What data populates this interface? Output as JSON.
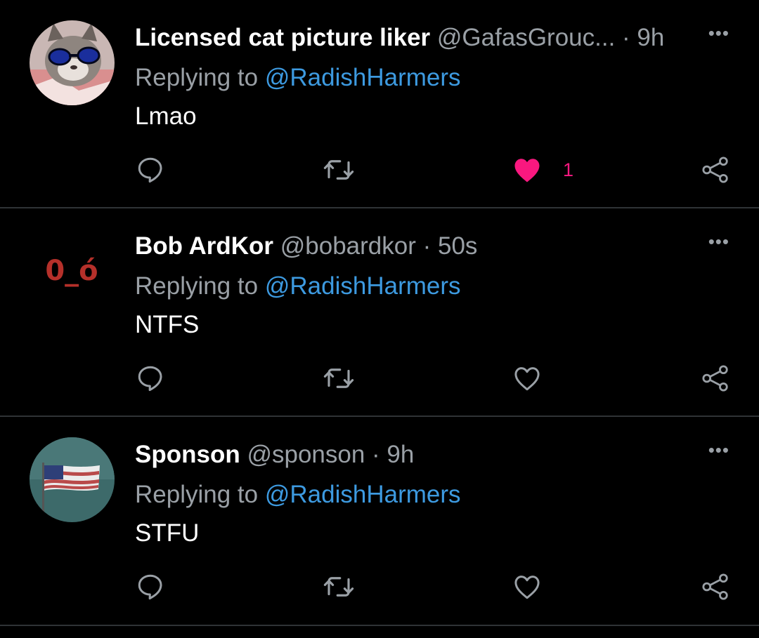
{
  "tweets": [
    {
      "name": "Licensed cat picture liker",
      "handle": "@GafasGrouc...",
      "time": "· 9h",
      "replying_prefix": "Replying to",
      "replying_to": "@RadishHarmers",
      "text": "Lmao",
      "liked": true,
      "like_count": "1",
      "avatar": "cat-sunglasses-avatar"
    },
    {
      "name": "Bob ArdKor",
      "handle": "@bobardkor",
      "time": "· 50s",
      "replying_prefix": "Replying to",
      "replying_to": "@RadishHarmers",
      "text": "NTFS",
      "liked": false,
      "like_count": "",
      "avatar_text": "0_ó"
    },
    {
      "name": "Sponson",
      "handle": "@sponson",
      "time": "· 9h",
      "replying_prefix": "Replying to",
      "replying_to": "@RadishHarmers",
      "text": "STFU",
      "liked": false,
      "like_count": "",
      "avatar": "flag-avatar"
    }
  ],
  "more_label": "•••",
  "colors": {
    "background": "#000000",
    "mention": "#3d9ae0",
    "muted": "#9aa0a6",
    "like": "#f9187f",
    "divider": "#2f3336"
  },
  "icons": [
    "reply-icon",
    "retweet-icon",
    "like-icon",
    "share-icon",
    "more-icon"
  ]
}
